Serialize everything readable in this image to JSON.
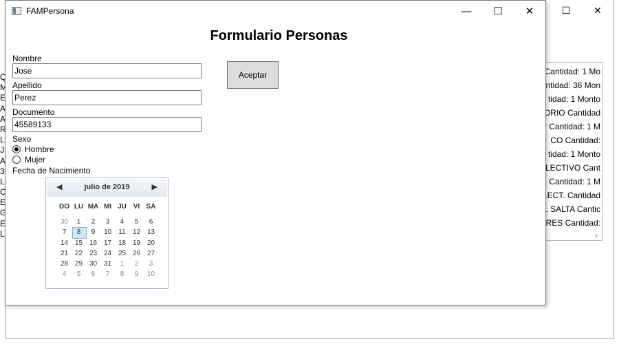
{
  "background_window": {
    "caption": {
      "maximize": "☐",
      "close": "✕"
    },
    "list_items": [
      "Cantidad: 1 Mo",
      "ntidad: 36 Mon",
      "tidad: 1 Monto",
      "ORIO Cantidad",
      "' Cantidad: 1 M",
      "CO Cantidad:",
      "tidad: 1 Monto",
      "OLECTIVO Cant",
      "Cantidad: 1 M",
      "LECT. Cantidad",
      "I. SALTA Cantic",
      "RES Cantidad:"
    ],
    "list_scroll_right": "›",
    "left_strip": [
      "Q",
      "M",
      "ER",
      "A",
      "AL",
      "R",
      "LI",
      "J",
      "AV",
      "30",
      "L",
      "C",
      "ER",
      "G",
      "E",
      "LE"
    ]
  },
  "window": {
    "title": "FAMPersona",
    "caption": {
      "minimize": "—",
      "maximize": "☐",
      "close": "✕"
    }
  },
  "form": {
    "title": "Formulario Personas",
    "nombre_label": "Nombre",
    "nombre_value": "Jose",
    "apellido_label": "Apellido",
    "apellido_value": "Perez",
    "documento_label": "Documento",
    "documento_value": "45589133",
    "sexo_label": "Sexo",
    "sexo_options": [
      "Hombre",
      "Mujer"
    ],
    "sexo_selected": "Hombre",
    "fecha_label": "Fecha de Nacimiento",
    "accept_label": "Aceptar"
  },
  "calendar": {
    "month_label": "julio de 2019",
    "prev": "◀",
    "next": "▶",
    "days_of_week": [
      "DO",
      "LU",
      "MA",
      "MI",
      "JU",
      "VI",
      "SA"
    ],
    "weeks": [
      [
        "30",
        "1",
        "2",
        "3",
        "4",
        "5",
        "6"
      ],
      [
        "7",
        "8",
        "9",
        "10",
        "11",
        "12",
        "13"
      ],
      [
        "14",
        "15",
        "16",
        "17",
        "18",
        "19",
        "20"
      ],
      [
        "21",
        "22",
        "23",
        "24",
        "25",
        "26",
        "27"
      ],
      [
        "28",
        "29",
        "30",
        "31",
        "1",
        "2",
        "3"
      ],
      [
        "4",
        "5",
        "6",
        "7",
        "8",
        "9",
        "10"
      ]
    ],
    "selected_day": "8",
    "colors": {
      "header": "#e4e9ef",
      "selected_bg": "#cfe6f6",
      "selected_border": "#7cb4d8"
    }
  }
}
